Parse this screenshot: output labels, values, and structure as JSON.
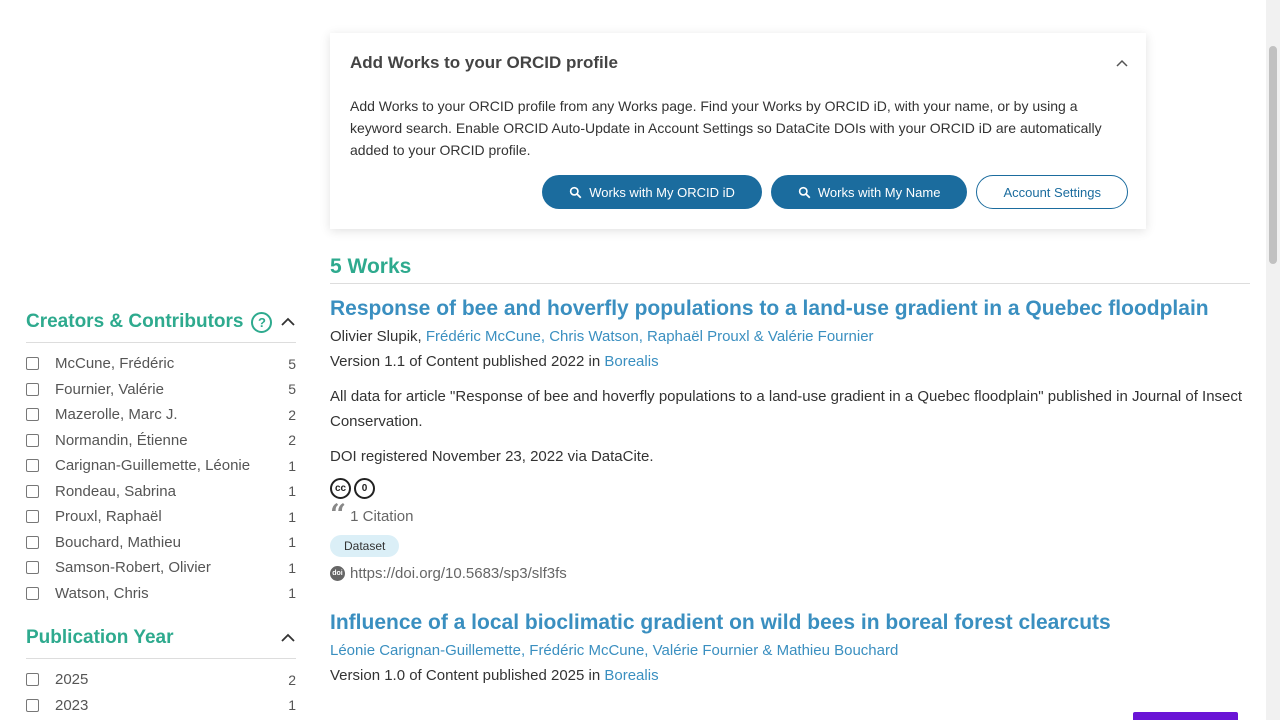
{
  "orcid_panel": {
    "title": "Add Works to your ORCID profile",
    "description": "Add Works to your ORCID profile from any Works page. Find your Works by ORCID iD, with your name, or by using a keyword search. Enable ORCID Auto-Update in Account Settings so DataCite DOIs with your ORCID iD are automatically added to your ORCID profile.",
    "btn_orcid": "Works with My ORCID iD",
    "btn_name": "Works with My Name",
    "btn_settings": "Account Settings"
  },
  "creators_facet": {
    "title": "Creators & Contributors",
    "help": "?",
    "items": [
      {
        "label": "McCune, Frédéric",
        "count": "5"
      },
      {
        "label": "Fournier, Valérie",
        "count": "5"
      },
      {
        "label": "Mazerolle, Marc J.",
        "count": "2"
      },
      {
        "label": "Normandin, Étienne",
        "count": "2"
      },
      {
        "label": "Carignan-Guillemette, Léonie",
        "count": "1"
      },
      {
        "label": "Rondeau, Sabrina",
        "count": "1"
      },
      {
        "label": "Prouxl, Raphaël",
        "count": "1"
      },
      {
        "label": "Bouchard, Mathieu",
        "count": "1"
      },
      {
        "label": "Samson-Robert, Olivier",
        "count": "1"
      },
      {
        "label": "Watson, Chris",
        "count": "1"
      }
    ]
  },
  "year_facet": {
    "title": "Publication Year",
    "items": [
      {
        "label": "2025",
        "count": "2"
      },
      {
        "label": "2023",
        "count": "1"
      }
    ]
  },
  "results": {
    "count_label": "5 Works",
    "works": [
      {
        "title": "Response of bee and hoverfly populations to a land-use gradient in a Quebec floodplain",
        "first_author": "Olivier Slupik, ",
        "linked_authors": "Frédéric McCune, Chris Watson, Raphaël Prouxl & Valérie Fournier",
        "version_prefix": "Version 1.1 of Content published 2022 in ",
        "repository": "Borealis",
        "description": "All data for article \"Response of bee and hoverfly populations to a land-use gradient in a Quebec floodplain\" published in Journal of Insect Conservation.",
        "doi_registered": "DOI registered November 23, 2022 via DataCite.",
        "license_cc": "cc",
        "license_zero": "0",
        "citations": "1 Citation",
        "type": "Dataset",
        "doi_badge": "doi",
        "doi_url": "https://doi.org/10.5683/sp3/slf3fs"
      },
      {
        "title": "Influence of a local bioclimatic gradient on wild bees in boreal forest clearcuts",
        "linked_authors": "Léonie Carignan-Guillemette, Frédéric McCune, Valérie Fournier & Mathieu Bouchard",
        "version_prefix": "Version 1.0 of Content published 2025 in ",
        "repository": "Borealis"
      }
    ]
  }
}
